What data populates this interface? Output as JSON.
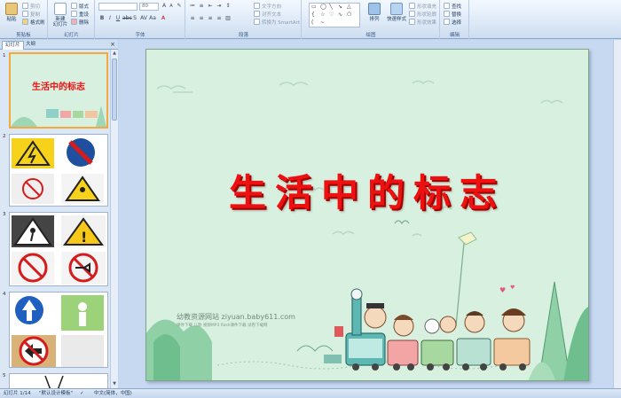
{
  "ribbon": {
    "clipboard": {
      "label": "剪贴板",
      "paste": "粘贴",
      "cut": "剪切",
      "copy": "复制",
      "format_painter": "格式刷"
    },
    "slides": {
      "label": "幻灯片",
      "new_slide": "新建\n幻灯片",
      "layout": "版式",
      "reset": "重设",
      "delete": "删除"
    },
    "font": {
      "label": "字体",
      "font_size": "80"
    },
    "paragraph": {
      "label": "段落",
      "text_direction": "文字方向",
      "align_text": "对齐文本",
      "smartart": "转换为 SmartArt"
    },
    "drawing": {
      "label": "绘图",
      "arrange": "排列",
      "quick_styles": "快速样式",
      "shape_fill": "形状填充",
      "shape_outline": "形状轮廓",
      "shape_effects": "形状效果"
    },
    "editing": {
      "label": "编辑",
      "find": "查找",
      "replace": "替换",
      "select": "选择"
    }
  },
  "left_panel": {
    "tabs": [
      "幻灯片",
      "大纲"
    ],
    "slides": [
      {
        "number": "1",
        "title": "生活中的标志"
      },
      {
        "number": "2"
      },
      {
        "number": "3"
      },
      {
        "number": "4"
      },
      {
        "number": "5"
      }
    ]
  },
  "slide": {
    "title": "生活中的标志",
    "watermark": "幼教资源网站  ziyuan.baby611.com",
    "watermark_sub": "课件下载  儿歌  视频MP3  flash课件下载  试卷下载网"
  },
  "status": {
    "slide_counter": "幻灯片 1/14",
    "theme": "\"默认设计模板\"",
    "language": "中文(简体，中国)"
  },
  "colors": {
    "title_red": "#ee1111",
    "slide_bg": "#d8f0df",
    "selection_orange": "#f3a93c"
  }
}
